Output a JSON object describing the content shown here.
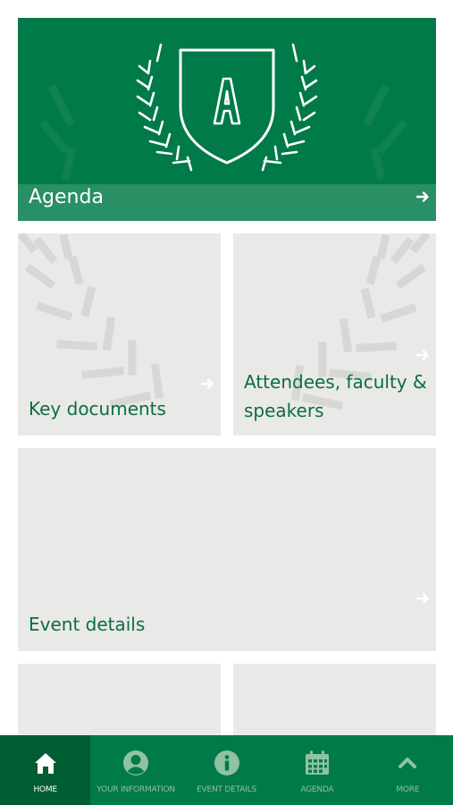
{
  "tiles": {
    "agenda": {
      "label": "Agenda",
      "logo_letter": "A"
    },
    "key_documents": {
      "label": "Key documents"
    },
    "attendees": {
      "label_line1": "Attendees, faculty &",
      "label_line2": "speakers"
    },
    "event_details": {
      "label": "Event details"
    }
  },
  "bottom_nav": {
    "items": [
      {
        "label": "HOME",
        "icon": "home-icon",
        "active": true
      },
      {
        "label": "YOUR INFORMATION",
        "icon": "user-icon",
        "active": false
      },
      {
        "label": "EVENT DETAILS",
        "icon": "info-icon",
        "active": false
      },
      {
        "label": "AGENDA",
        "icon": "calendar-icon",
        "active": false
      },
      {
        "label": "MORE",
        "icon": "chevron-up-icon",
        "active": false
      }
    ]
  },
  "colors": {
    "brand_green": "#007a48",
    "nav_active": "#005c33",
    "tile_bg": "#e9e9e8",
    "tile_text": "#0b6e3e"
  }
}
